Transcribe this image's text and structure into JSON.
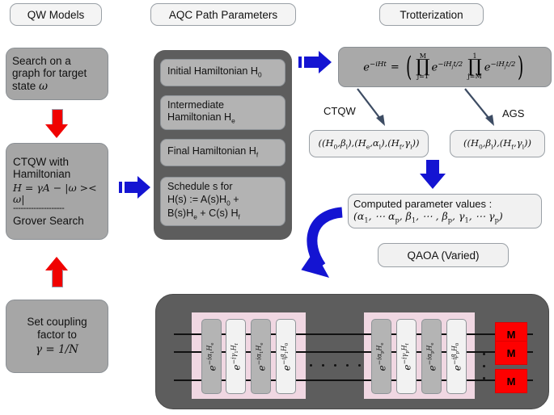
{
  "colors": {
    "red_arrow": "#f00201",
    "blue_arrow": "#1414d2",
    "gray_box": "#a6a6a6",
    "dark_container": "#5d5d5d",
    "group_pink": "#f0d7e2",
    "measure_red": "#fe0000"
  },
  "columns": {
    "qw_models": {
      "header": "QW Models",
      "boxes": [
        {
          "lines": [
            "Search on a",
            "graph for target",
            "state ω"
          ]
        },
        {
          "lines": [
            "CTQW with",
            "Hamiltonian",
            "H = γA − |ω >< ω|",
            "--------------------",
            "Grover Search"
          ]
        },
        {
          "lines": [
            "Set coupling",
            "factor to",
            "γ = 1/N"
          ]
        }
      ]
    },
    "aqc": {
      "header": "AQC Path Parameters",
      "items": [
        {
          "lines": [
            "Initial Hamiltonian H₀"
          ]
        },
        {
          "lines": [
            "Intermediate",
            "Hamiltonian Hₑ"
          ]
        },
        {
          "lines": [
            "Final Hamiltonian Hᶠ"
          ]
        },
        {
          "lines": [
            "Schedule s for",
            "H(s) := A(s)H₀ +",
            "B(s)Hₑ + C(s) Hᶠ"
          ]
        }
      ]
    },
    "trotterization": {
      "header": "Trotterization",
      "equation": "e⁻ⁱᴴᵗ = ( ∏ⱼ₌₁ᴹ e⁻ⁱᴴⱼᵗᐟ² ∏ⱼ₌ᴹ¹ e⁻ⁱᴴⱼᵗᐟ² )",
      "equation_parts": {
        "lhs": "e",
        "lhs_exp": "−iHt",
        "eq": "=",
        "prod1_top": "M",
        "prod1_bot": "j=1",
        "term1": "e",
        "term1_exp": "−iHⱼt/2",
        "prod2_top": "1",
        "prod2_bot": "j=M",
        "term2": "e",
        "term2_exp": "−iHⱼt/2"
      },
      "branch_labels": {
        "left": "CTQW",
        "right": "AGS"
      },
      "param_boxes": {
        "ctqw": "((H₀, βₗ), (Hₑ, αₗ), (Hᶠ, γₗ))",
        "ags": "((H₀, βₗ), (Hᶠ, γₗ))"
      },
      "computed": {
        "title": "Computed parameter values :",
        "value": "(α₁, ⋯ αₚ, β₁, ⋯ , βₚ, γ₁, ⋯ γₚ)"
      },
      "qaoa_label": "QAOA (Varied)"
    }
  },
  "circuit": {
    "group_left": {
      "gates": [
        {
          "base": "e",
          "exp": "−iα₁Hₑ",
          "style": "dark"
        },
        {
          "base": "e",
          "exp": "−iγ₁Hᶠ",
          "style": "light"
        },
        {
          "base": "e",
          "exp": "−iα₁Hₑ",
          "style": "dark"
        },
        {
          "base": "e",
          "exp": "−iβ₁H₀",
          "style": "light"
        }
      ]
    },
    "group_right": {
      "gates": [
        {
          "base": "e",
          "exp": "−iαₚHₑ",
          "style": "dark"
        },
        {
          "base": "e",
          "exp": "−iγₚHᶠ",
          "style": "light"
        },
        {
          "base": "e",
          "exp": "−iαₚHₑ",
          "style": "dark"
        },
        {
          "base": "e",
          "exp": "−iβₚH₀",
          "style": "light"
        }
      ]
    },
    "ellipsis_dots": 5,
    "vertical_dots": 3,
    "measurements": [
      "M",
      "M",
      "M"
    ],
    "wire_count": 3
  }
}
